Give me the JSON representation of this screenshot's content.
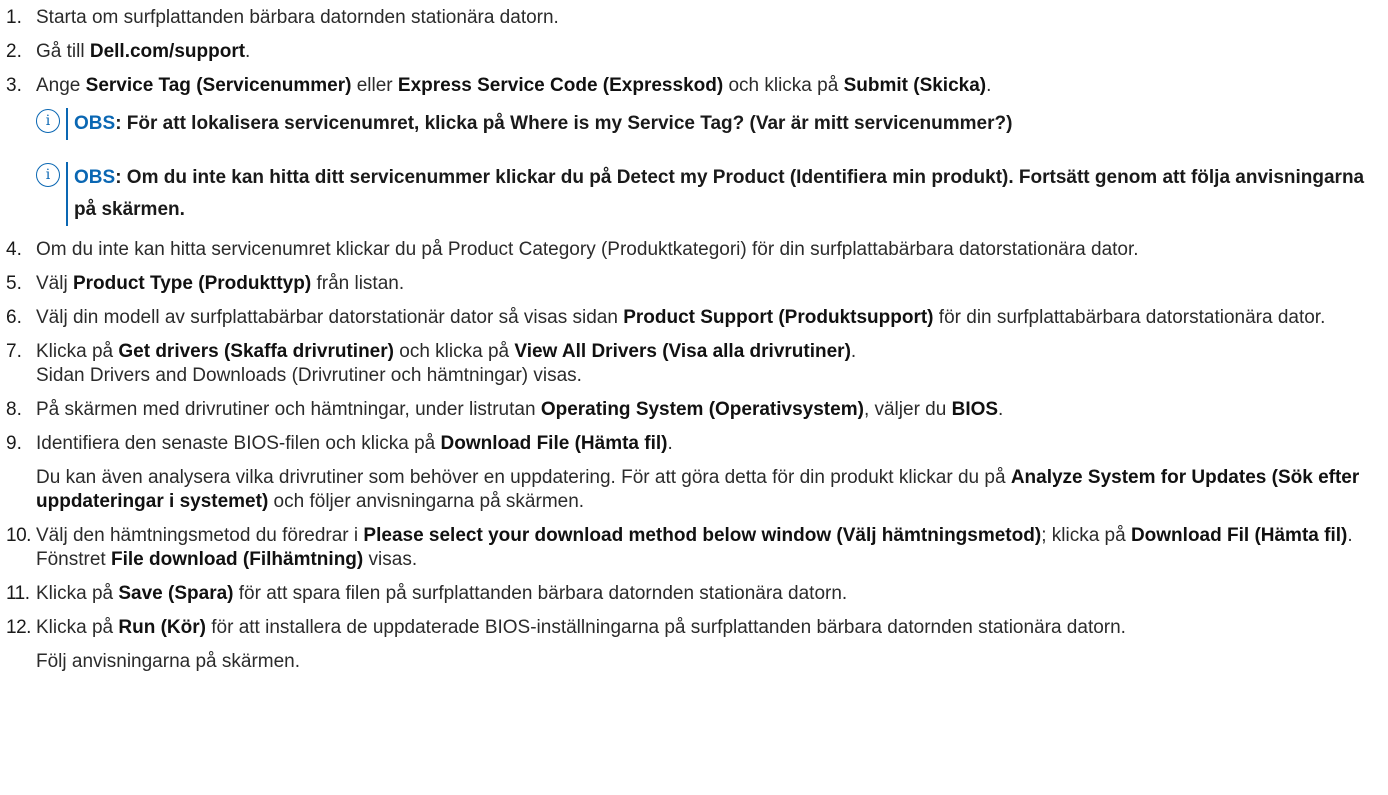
{
  "steps": [
    {
      "num": "1.",
      "parts": [
        "Starta om surfplattanden bärbara datornden stationära datorn."
      ]
    },
    {
      "num": "2.",
      "pre": "Gå till ",
      "bold": "Dell.com/support",
      "post": "."
    },
    {
      "num": "3.",
      "s3": {
        "a": "Ange ",
        "b": "Service Tag (Servicenummer)",
        "c": " eller ",
        "d": "Express Service Code (Expresskod)",
        "e": " och klicka på ",
        "f": "Submit (Skicka)",
        "g": "."
      }
    },
    {
      "num": "4.",
      "text": "Om du inte kan hitta servicenumret klickar du på Product Category (Produktkategori) för din surfplattabärbara datorstationära dator."
    },
    {
      "num": "5.",
      "pre": "Välj ",
      "bold": "Product Type (Produkttyp)",
      "post": " från listan."
    },
    {
      "num": "6.",
      "pre": "Välj din modell av surfplattabärbar datorstationär dator så visas sidan ",
      "bold": "Product Support (Produktsupport)",
      "post": " för din surfplattabärbara datorstationära dator."
    },
    {
      "num": "7.",
      "a": "Klicka på ",
      "b": "Get drivers (Skaffa drivrutiner)",
      "c": " och klicka på ",
      "d": "View All Drivers (Visa alla drivrutiner)",
      "e": ".",
      "sub": "Sidan Drivers and Downloads (Drivrutiner och hämtningar) visas."
    },
    {
      "num": "8.",
      "a": "På skärmen med drivrutiner och hämtningar, under listrutan ",
      "b": "Operating System (Operativsystem)",
      "c": ", väljer du ",
      "d": "BIOS",
      "e": "."
    },
    {
      "num": "9.",
      "a": "Identifiera den senaste BIOS-filen och klicka på ",
      "b": "Download File (Hämta fil)",
      "c": ".",
      "sub_a": "Du kan även analysera vilka drivrutiner som behöver en uppdatering. För att göra detta för din produkt klickar du på ",
      "sub_b": "Analyze System for Updates (Sök efter uppdateringar i systemet)",
      "sub_c": " och följer anvisningarna på skärmen."
    },
    {
      "num": "10.",
      "a": "Välj den hämtningsmetod du föredrar i ",
      "b": "Please select your download method below window (Välj hämtningsmetod)",
      "c": "; klicka på ",
      "d": "Download Fil (Hämta fil)",
      "e": ".",
      "sub_a": "Fönstret ",
      "sub_b": "File download (Filhämtning)",
      "sub_c": " visas."
    },
    {
      "num": "11.",
      "a": "Klicka på ",
      "b": "Save (Spara)",
      "c": " för att spara filen på surfplattanden bärbara datornden stationära datorn."
    },
    {
      "num": "12.",
      "a": "Klicka på ",
      "b": "Run (Kör)",
      "c": " för att installera de uppdaterade BIOS-inställningarna på surfplattanden bärbara datornden stationära datorn.",
      "sub": "Följ anvisningarna på skärmen."
    }
  ],
  "notes": [
    {
      "icon": "i",
      "label": "OBS",
      "text": ": För att lokalisera servicenumret, klicka på Where is my Service Tag? (Var är mitt servicenummer?)"
    },
    {
      "icon": "i",
      "label": "OBS",
      "text": ": Om du inte kan hitta ditt servicenummer klickar du på Detect my Product (Identifiera min produkt). Fortsätt genom att följa anvisningarna på skärmen."
    }
  ]
}
